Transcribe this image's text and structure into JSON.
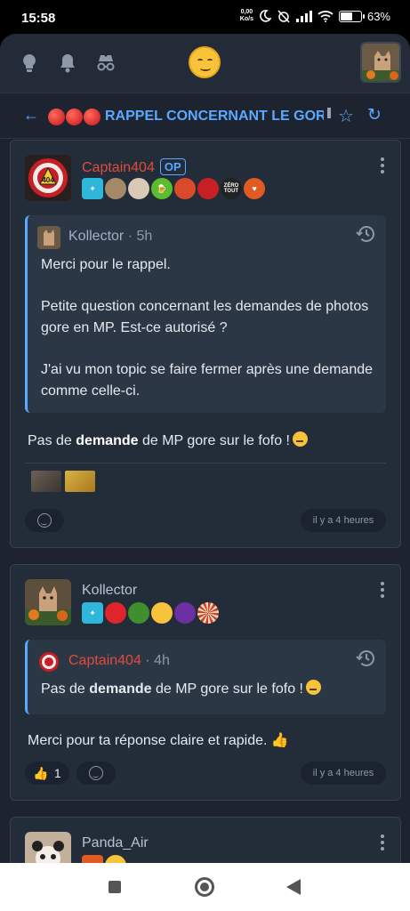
{
  "status": {
    "time": "15:58",
    "speed": "0,00",
    "speed_unit": "Ko/s",
    "battery_percent": "63%",
    "battery_level": 0.63
  },
  "nav": {
    "icons": [
      "lightbulb-icon",
      "bell-icon",
      "incognito-icon"
    ],
    "emoji": "smiley-emoji"
  },
  "topic": {
    "title": "RAPPEL CONCERNANT LE GOR",
    "prefix_dots": 3
  },
  "posts": [
    {
      "author": "Captain404",
      "author_color": "#e04b3a",
      "op_badge": "OP",
      "avatar_text": "404",
      "badges": [
        "",
        "",
        "",
        "",
        "",
        "",
        "ZÉRO TOUT",
        ""
      ],
      "quote": {
        "author": "Kollector",
        "time": "· 5h",
        "paragraphs": [
          "Merci pour le rappel.",
          "Petite question concernant les demandes de photos gore en MP. Est-ce autorisé ?",
          "J'ai vu mon topic se faire fermer après une demande comme celle-ci."
        ]
      },
      "text_before": "Pas de ",
      "text_bold": "demande",
      "text_after": " de MP gore sur le fofo !",
      "time": "il y a 4 heures"
    },
    {
      "author": "Kollector",
      "author_color": "#b7c3d1",
      "quote": {
        "author": "Captain404",
        "time": "· 4h",
        "text_before": "Pas de ",
        "text_bold": "demande",
        "text_after": " de MP gore sur le fofo !"
      },
      "text": "Merci pour ta réponse claire et rapide.",
      "reaction_count": "1",
      "time": "il y a 4 heures"
    },
    {
      "author": "Panda_Air",
      "author_color": "#b7c3d1"
    }
  ]
}
